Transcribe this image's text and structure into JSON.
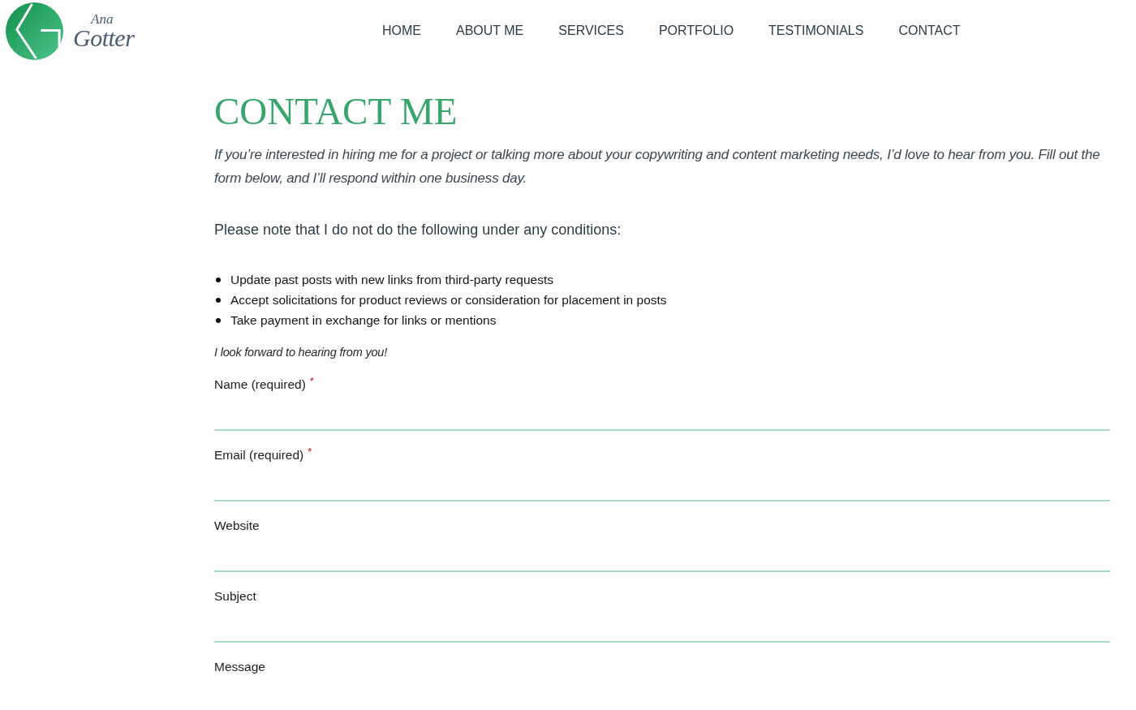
{
  "logo": {
    "line_1": "Ana",
    "line_2": "Gotter"
  },
  "nav": [
    "HOME",
    "ABOUT ME",
    "SERVICES",
    "PORTFOLIO",
    "TESTIMONIALS",
    "CONTACT"
  ],
  "page": {
    "title": "CONTACT ME",
    "intro": "If you’re interested in hiring me for a project or talking more about your copywriting and content marketing needs, I’d love to hear from you. Fill out the form below, and I’ll respond within one business day.",
    "note": "Please note that I do not do the following under any conditions:",
    "exclusions": [
      "Update past posts with new links from third-party requests",
      "Accept solicitations for product reviews or consideration for placement in posts",
      "Take payment in exchange for links or mentions"
    ],
    "closing": "I look forward to hearing from you!"
  },
  "form": {
    "fields": [
      {
        "kind": "line",
        "label": "Name (required)",
        "marker": "*"
      },
      {
        "kind": "line",
        "label": "Email (required)",
        "marker": "*"
      },
      {
        "kind": "line",
        "label": "Website"
      },
      {
        "kind": "line",
        "label": "Subject"
      },
      {
        "kind": "textarea",
        "label": "Message"
      }
    ]
  }
}
